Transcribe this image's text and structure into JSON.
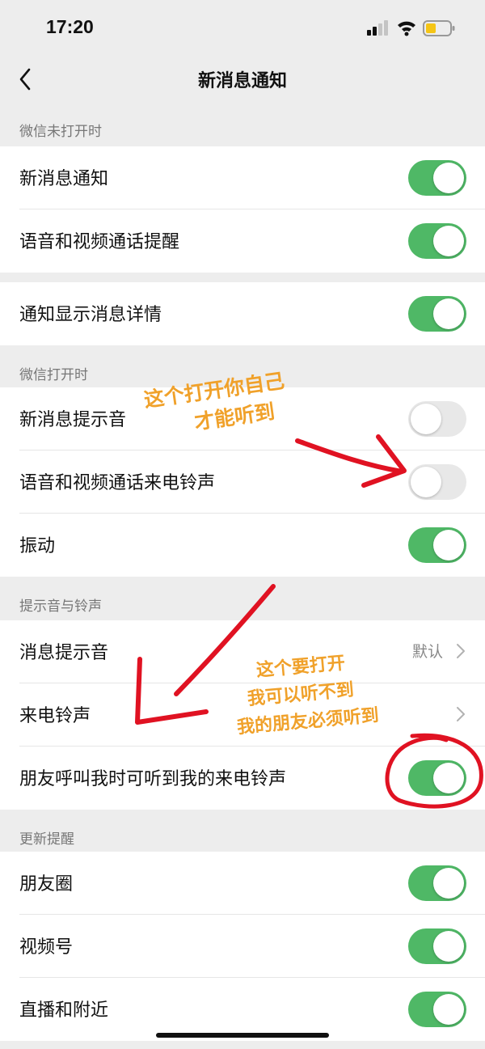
{
  "status": {
    "time": "17:20"
  },
  "nav": {
    "title": "新消息通知"
  },
  "sections": [
    {
      "header": "微信未打开时",
      "rows": [
        {
          "label": "新消息通知",
          "toggle": "on"
        },
        {
          "label": "语音和视频通话提醒",
          "toggle": "on"
        }
      ]
    },
    {
      "header": "",
      "rows": [
        {
          "label": "通知显示消息详情",
          "toggle": "on"
        }
      ]
    },
    {
      "header": "微信打开时",
      "rows": [
        {
          "label": "新消息提示音",
          "toggle": "off"
        },
        {
          "label": "语音和视频通话来电铃声",
          "toggle": "off"
        },
        {
          "label": "振动",
          "toggle": "on"
        }
      ]
    },
    {
      "header": "提示音与铃声",
      "rows": [
        {
          "label": "消息提示音",
          "value": "默认"
        },
        {
          "label": "来电铃声",
          "value": ""
        },
        {
          "label": "朋友呼叫我时可听到我的来电铃声",
          "toggle": "on"
        }
      ]
    },
    {
      "header": "更新提醒",
      "rows": [
        {
          "label": "朋友圈",
          "toggle": "on"
        },
        {
          "label": "视频号",
          "toggle": "on"
        },
        {
          "label": "直播和附近",
          "toggle": "on"
        }
      ]
    }
  ],
  "annotations": {
    "note1": {
      "line1": "这个打开你自己",
      "line2": "才能听到"
    },
    "note2": {
      "line1": "这个要打开",
      "line2": "我可以听不到",
      "line3": "我的朋友必须听到"
    }
  },
  "colors": {
    "toggle_on": "#4fb866",
    "toggle_off": "#e8e8e8",
    "annotation_text": "#f0a12a",
    "annotation_ink": "#e01222",
    "background": "#ededed"
  },
  "icons": [
    "signal-icon",
    "wifi-icon",
    "battery-icon",
    "back-chevron-icon",
    "chevron-right-icon"
  ]
}
